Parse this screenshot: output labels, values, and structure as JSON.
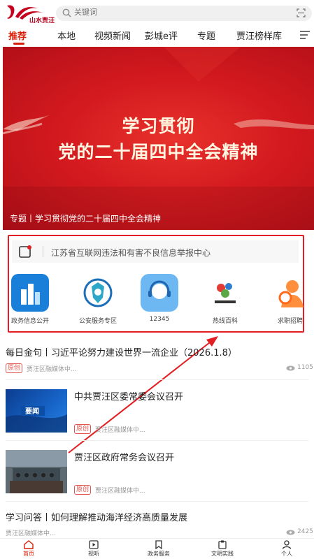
{
  "header": {
    "logo_text": "山水贾汪",
    "search_placeholder": "关键词",
    "icons": {
      "search": "search-icon",
      "scan": "scan-icon"
    }
  },
  "tabs": [
    {
      "label": "推荐",
      "active": true
    },
    {
      "label": "本地"
    },
    {
      "label": "视频新闻"
    },
    {
      "label": "彭城e评"
    },
    {
      "label": "专题"
    },
    {
      "label": "贾汪榜样库"
    }
  ],
  "banner": {
    "headline_line1": "学习贯彻",
    "headline_line2": "党的二十届四中全会精神",
    "caption": "专题丨学习贯彻党的二十届四中全会精神"
  },
  "report": {
    "text": "江苏省互联网违法和有害不良信息举报中心"
  },
  "services": [
    {
      "label": "政务信息公开",
      "icon": "building-icon"
    },
    {
      "label": "公安服务专区",
      "icon": "police-badge-icon"
    },
    {
      "label": "12345",
      "icon": "headset-icon"
    },
    {
      "label": "热线百科",
      "icon": "hotline-encyclopedia-icon"
    },
    {
      "label": "求职招聘",
      "icon": "job-search-icon"
    }
  ],
  "news": [
    {
      "title": "每日金句丨习近平论努力建设世界一流企业（2026.1.8）",
      "tag": "原创",
      "source": "贾汪区融媒体中...",
      "views": "1105"
    },
    {
      "title": "中共贾汪区委常委会议召开",
      "tag": "原创",
      "source": "贾汪区融媒体中...",
      "thumb_text": "要闻"
    },
    {
      "title": "贾汪区政府常务会议召开",
      "tag": "原创",
      "source": "贾汪区融媒体中..."
    },
    {
      "title": "学习问答丨如何理解推动海洋经济高质量发展",
      "source": "贾汪区融媒体中...",
      "views": "2425"
    }
  ],
  "bottom_nav": [
    {
      "label": "首页",
      "icon": "home-icon",
      "active": true
    },
    {
      "label": "视听",
      "icon": "play-icon"
    },
    {
      "label": "政务服务",
      "icon": "bookmark-icon"
    },
    {
      "label": "文明实践",
      "icon": "clipboard-icon"
    },
    {
      "label": "个人",
      "icon": "user-icon"
    }
  ],
  "colors": {
    "accent": "#d81e06",
    "highlight_box": "#e21e22"
  }
}
